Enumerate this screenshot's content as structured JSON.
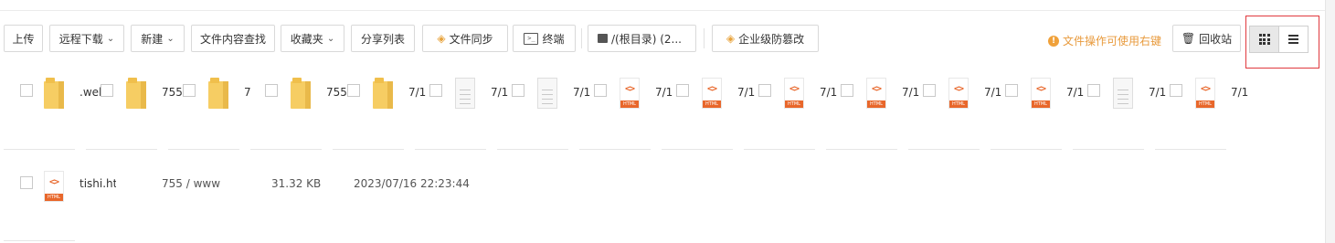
{
  "toolbar": {
    "upload": "上传",
    "remote_download": "远程下载",
    "new": "新建",
    "content_search": "文件内容查找",
    "favorites": "收藏夹",
    "share_list": "分享列表",
    "file_sync": "文件同步",
    "terminal": "终端",
    "path": "/(根目录) (2...",
    "tamper_proof": "企业级防篡改",
    "hint": "文件操作可使用右键",
    "recycle_bin": "回收站",
    "view_grid_icon": "grid-icon",
    "view_list_icon": "list-icon"
  },
  "grid_row": {
    "items": [
      {
        "name": ".well",
        "icon": "folder"
      },
      {
        "name": "755",
        "icon": "folder"
      },
      {
        "name": "7",
        "icon": "folder"
      },
      {
        "name": "755",
        "icon": "folder"
      },
      {
        "name": "7/1",
        "icon": "folder"
      },
      {
        "name": "7/1",
        "icon": "file"
      },
      {
        "name": "7/1",
        "icon": "file"
      },
      {
        "name": "7/1",
        "icon": "html"
      },
      {
        "name": "7/1",
        "icon": "html"
      },
      {
        "name": "7/1",
        "icon": "html"
      },
      {
        "name": "7/1",
        "icon": "html"
      },
      {
        "name": "7/1",
        "icon": "html"
      },
      {
        "name": "7/1",
        "icon": "html"
      },
      {
        "name": "7/1",
        "icon": "file"
      },
      {
        "name": "7/1",
        "icon": "html"
      }
    ]
  },
  "file_row": {
    "name": "tishi.htm",
    "permission": "755 / www",
    "size": "31.32 KB",
    "modified": "2023/07/16 22:23:44"
  }
}
